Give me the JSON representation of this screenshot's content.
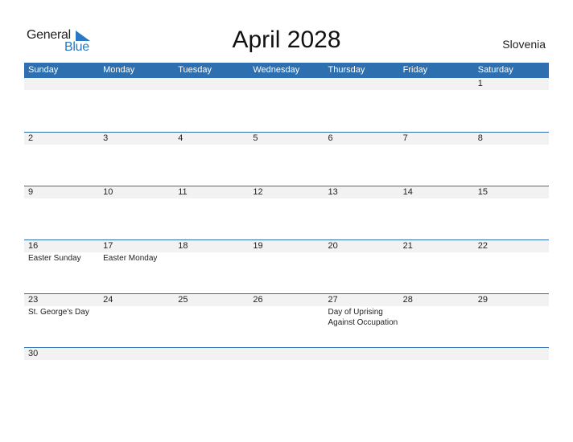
{
  "logo": {
    "word1": "General",
    "word2": "Blue",
    "accent": "#2b78c2"
  },
  "title": "April 2028",
  "country": "Slovenia",
  "colors": {
    "header_bg": "#2e6fb0",
    "date_strip": "#f2f2f2"
  },
  "weekdays": [
    "Sunday",
    "Monday",
    "Tuesday",
    "Wednesday",
    "Thursday",
    "Friday",
    "Saturday"
  ],
  "weeks": [
    {
      "days": [
        {
          "day": "",
          "event": ""
        },
        {
          "day": "",
          "event": ""
        },
        {
          "day": "",
          "event": ""
        },
        {
          "day": "",
          "event": ""
        },
        {
          "day": "",
          "event": ""
        },
        {
          "day": "",
          "event": ""
        },
        {
          "day": "1",
          "event": ""
        }
      ]
    },
    {
      "days": [
        {
          "day": "2",
          "event": ""
        },
        {
          "day": "3",
          "event": ""
        },
        {
          "day": "4",
          "event": ""
        },
        {
          "day": "5",
          "event": ""
        },
        {
          "day": "6",
          "event": ""
        },
        {
          "day": "7",
          "event": ""
        },
        {
          "day": "8",
          "event": ""
        }
      ]
    },
    {
      "days": [
        {
          "day": "9",
          "event": ""
        },
        {
          "day": "10",
          "event": ""
        },
        {
          "day": "11",
          "event": ""
        },
        {
          "day": "12",
          "event": ""
        },
        {
          "day": "13",
          "event": ""
        },
        {
          "day": "14",
          "event": ""
        },
        {
          "day": "15",
          "event": ""
        }
      ]
    },
    {
      "days": [
        {
          "day": "16",
          "event": "Easter Sunday"
        },
        {
          "day": "17",
          "event": "Easter Monday"
        },
        {
          "day": "18",
          "event": ""
        },
        {
          "day": "19",
          "event": ""
        },
        {
          "day": "20",
          "event": ""
        },
        {
          "day": "21",
          "event": ""
        },
        {
          "day": "22",
          "event": ""
        }
      ]
    },
    {
      "days": [
        {
          "day": "23",
          "event": "St. George's Day"
        },
        {
          "day": "24",
          "event": ""
        },
        {
          "day": "25",
          "event": ""
        },
        {
          "day": "26",
          "event": ""
        },
        {
          "day": "27",
          "event": "Day of Uprising Against Occupation"
        },
        {
          "day": "28",
          "event": ""
        },
        {
          "day": "29",
          "event": ""
        }
      ]
    },
    {
      "days": [
        {
          "day": "30",
          "event": ""
        },
        {
          "day": "",
          "event": ""
        },
        {
          "day": "",
          "event": ""
        },
        {
          "day": "",
          "event": ""
        },
        {
          "day": "",
          "event": ""
        },
        {
          "day": "",
          "event": ""
        },
        {
          "day": "",
          "event": ""
        }
      ]
    }
  ]
}
